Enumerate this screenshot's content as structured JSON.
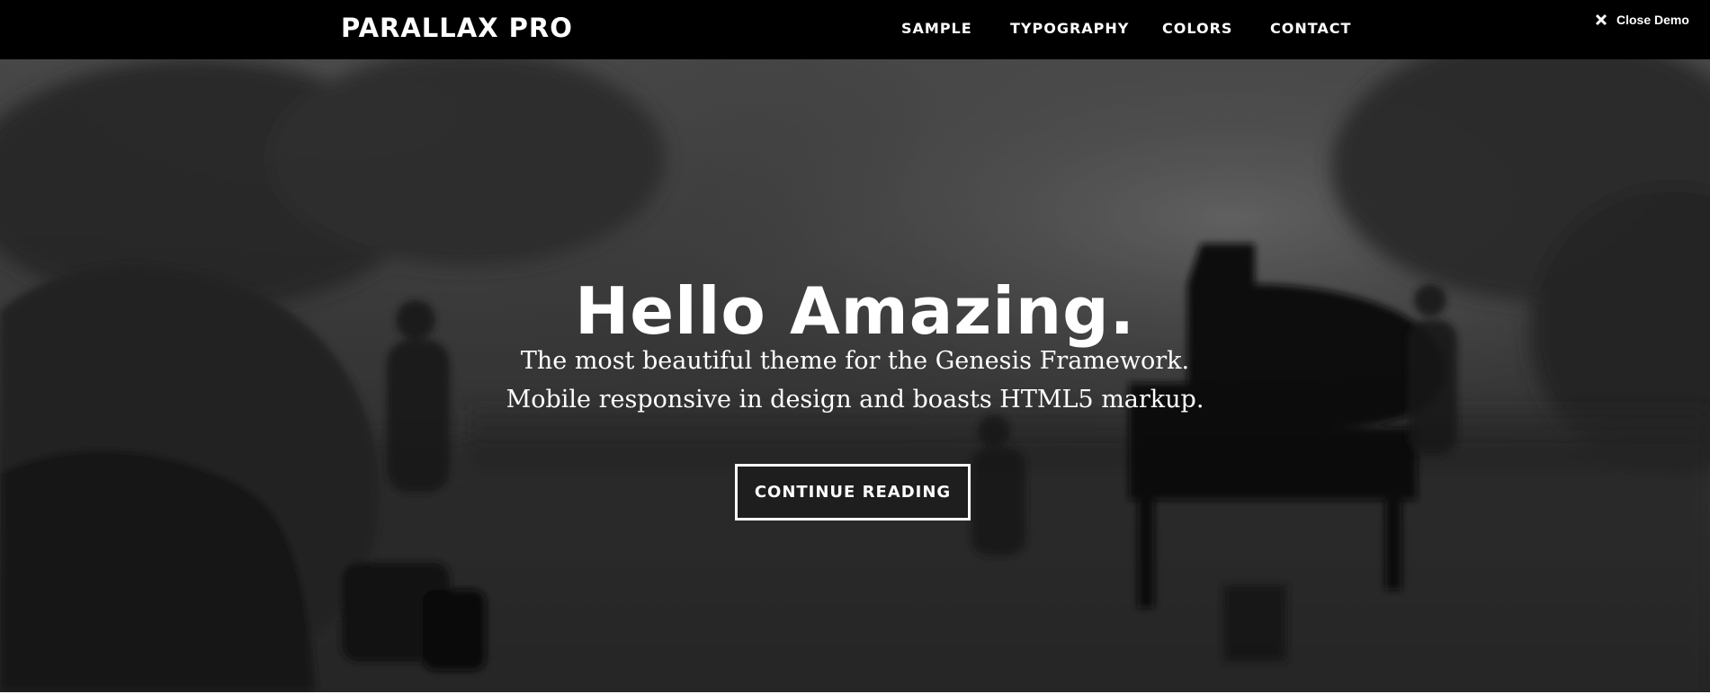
{
  "header": {
    "site_title": "PARALLAX PRO",
    "nav": [
      "SAMPLE",
      "TYPOGRAPHY",
      "COLORS",
      "CONTACT"
    ],
    "close_demo_label": "Close Demo",
    "close_icon": "close-icon"
  },
  "hero": {
    "title": "Hello Amazing.",
    "text_line1": "The most beautiful theme for the Genesis Framework.",
    "text_line2": "Mobile responsive in design and boasts HTML5 markup.",
    "button_label": "CONTINUE READING"
  },
  "colors": {
    "header_bg": "#000000",
    "text": "#ffffff",
    "hero_tint": "#3b3b3b"
  }
}
